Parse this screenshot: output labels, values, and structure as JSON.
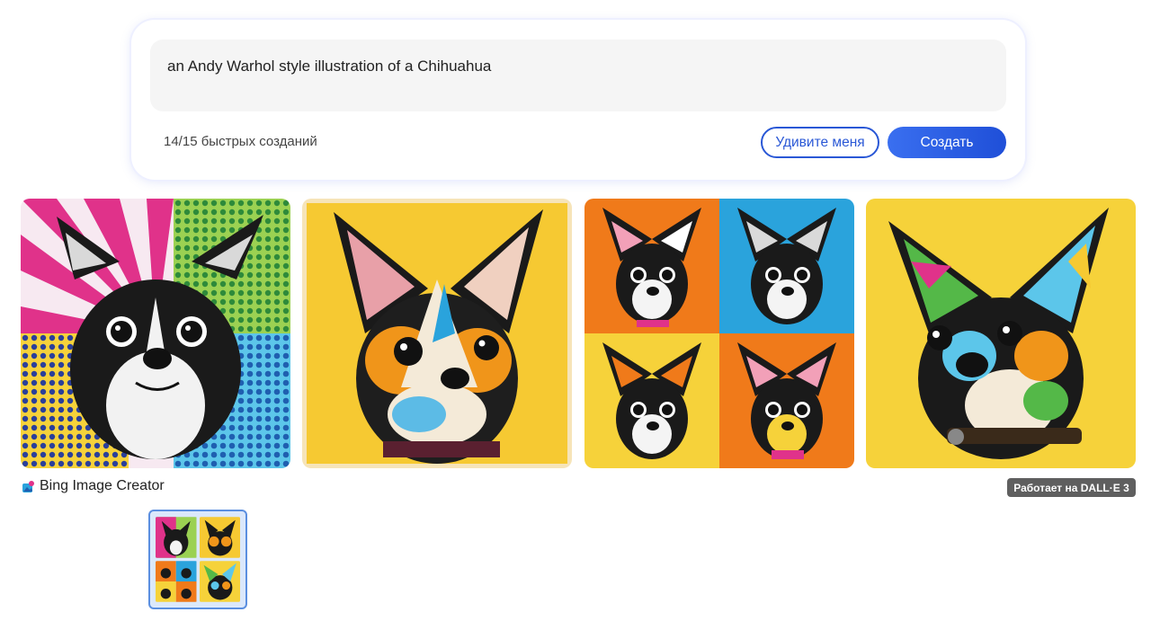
{
  "prompt": {
    "text": "an Andy Warhol style illustration of a Chihuahua"
  },
  "counter": "14/15 быстрых созданий",
  "buttons": {
    "surprise": "Удивите меня",
    "create": "Создать"
  },
  "images": [
    {
      "name": "chihuahua-pop-art-1"
    },
    {
      "name": "chihuahua-pop-art-2"
    },
    {
      "name": "chihuahua-pop-art-3"
    },
    {
      "name": "chihuahua-pop-art-4"
    }
  ],
  "brand": {
    "label": "Bing Image Creator",
    "icon": "bing-image-creator-icon"
  },
  "badge": "Работает на DALL·E 3",
  "colors": {
    "accent": "#2a58d6",
    "yellow": "#f6c932",
    "orange": "#f07a1a",
    "blue": "#2aa3dc",
    "magenta": "#e0328a",
    "green": "#54b848"
  }
}
